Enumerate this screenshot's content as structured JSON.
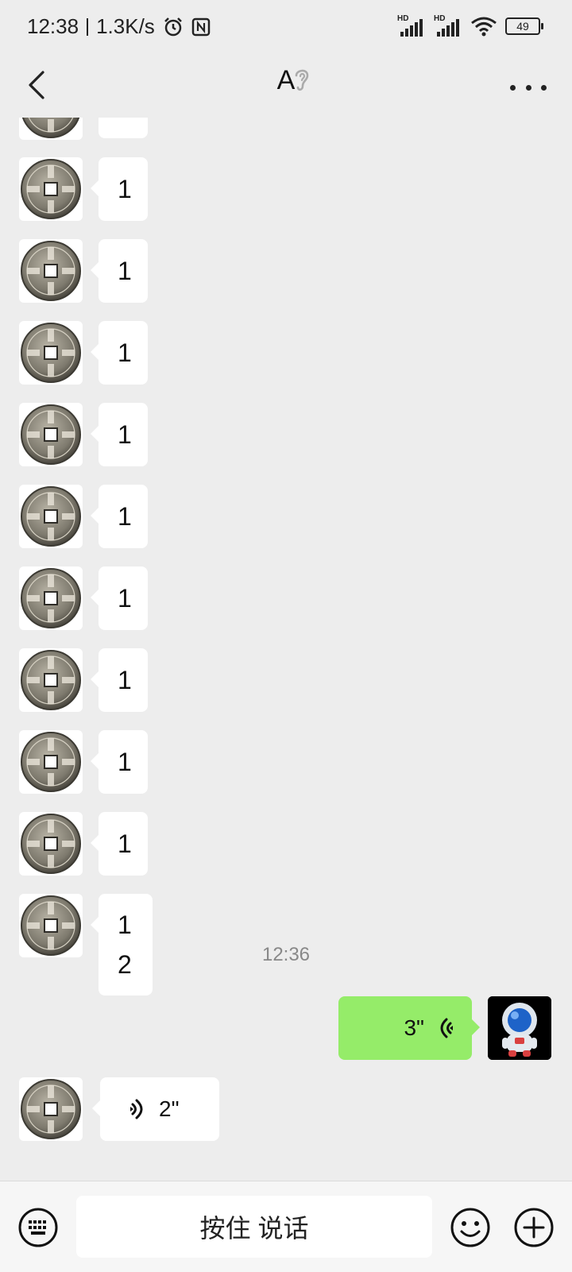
{
  "status_bar": {
    "time": "12:38",
    "net_speed": "1.3K/s",
    "battery": "49",
    "hd_label": "HD"
  },
  "header": {
    "title": "A",
    "back_icon": "chevron-left-icon",
    "ear_icon": "ear-icon",
    "more_icon": "more-dots-icon"
  },
  "messages": [
    {
      "sender": "other",
      "text": "1"
    },
    {
      "sender": "other",
      "text": "1"
    },
    {
      "sender": "other",
      "text": "1"
    },
    {
      "sender": "other",
      "text": "1"
    },
    {
      "sender": "other",
      "text": "1"
    },
    {
      "sender": "other",
      "text": "1"
    },
    {
      "sender": "other",
      "text": "1"
    },
    {
      "sender": "other",
      "text": "1"
    },
    {
      "sender": "other",
      "text": "1"
    },
    {
      "sender": "other",
      "lines": [
        "1",
        "2"
      ]
    }
  ],
  "timestamp": "12:36",
  "voice_sent": {
    "duration": "3\""
  },
  "voice_received": {
    "duration": "2\""
  },
  "input_bar": {
    "hold_to_talk": "按住 说话",
    "keyboard_icon": "keyboard-icon",
    "emoji_icon": "emoji-icon",
    "plus_icon": "plus-icon"
  },
  "colors": {
    "background": "#ededed",
    "sent_bubble": "#95ec69",
    "received_bubble": "#ffffff"
  }
}
